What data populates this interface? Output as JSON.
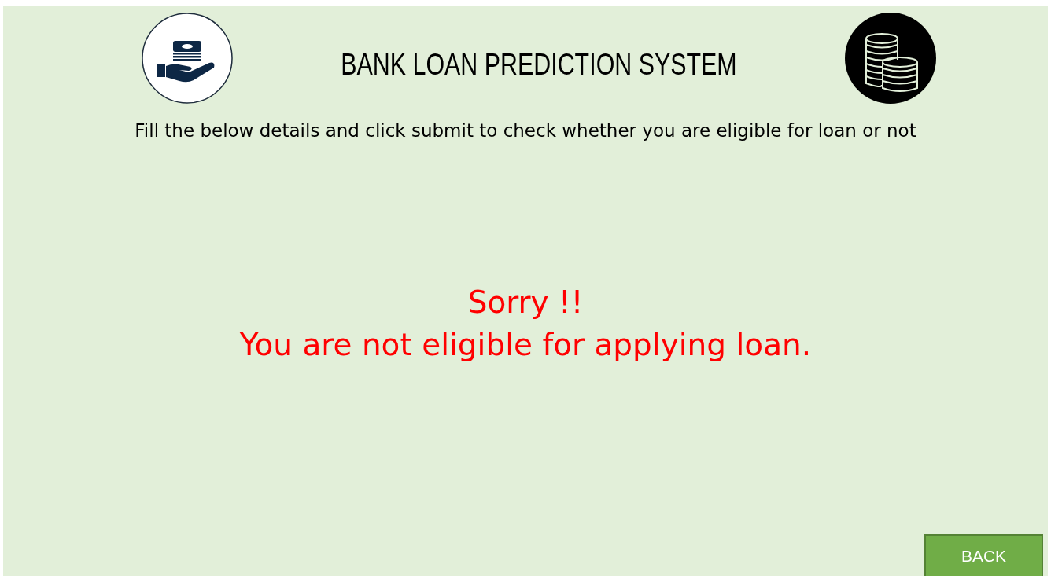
{
  "header": {
    "title": "BANK LOAN PREDICTION SYSTEM",
    "subtitle": "Fill the below details and click submit to check whether you are eligible for loan or not"
  },
  "result": {
    "lines": [
      "Sorry !!",
      "You are not eligible for applying loan."
    ]
  },
  "buttons": [
    {
      "label": "BACK"
    }
  ]
}
